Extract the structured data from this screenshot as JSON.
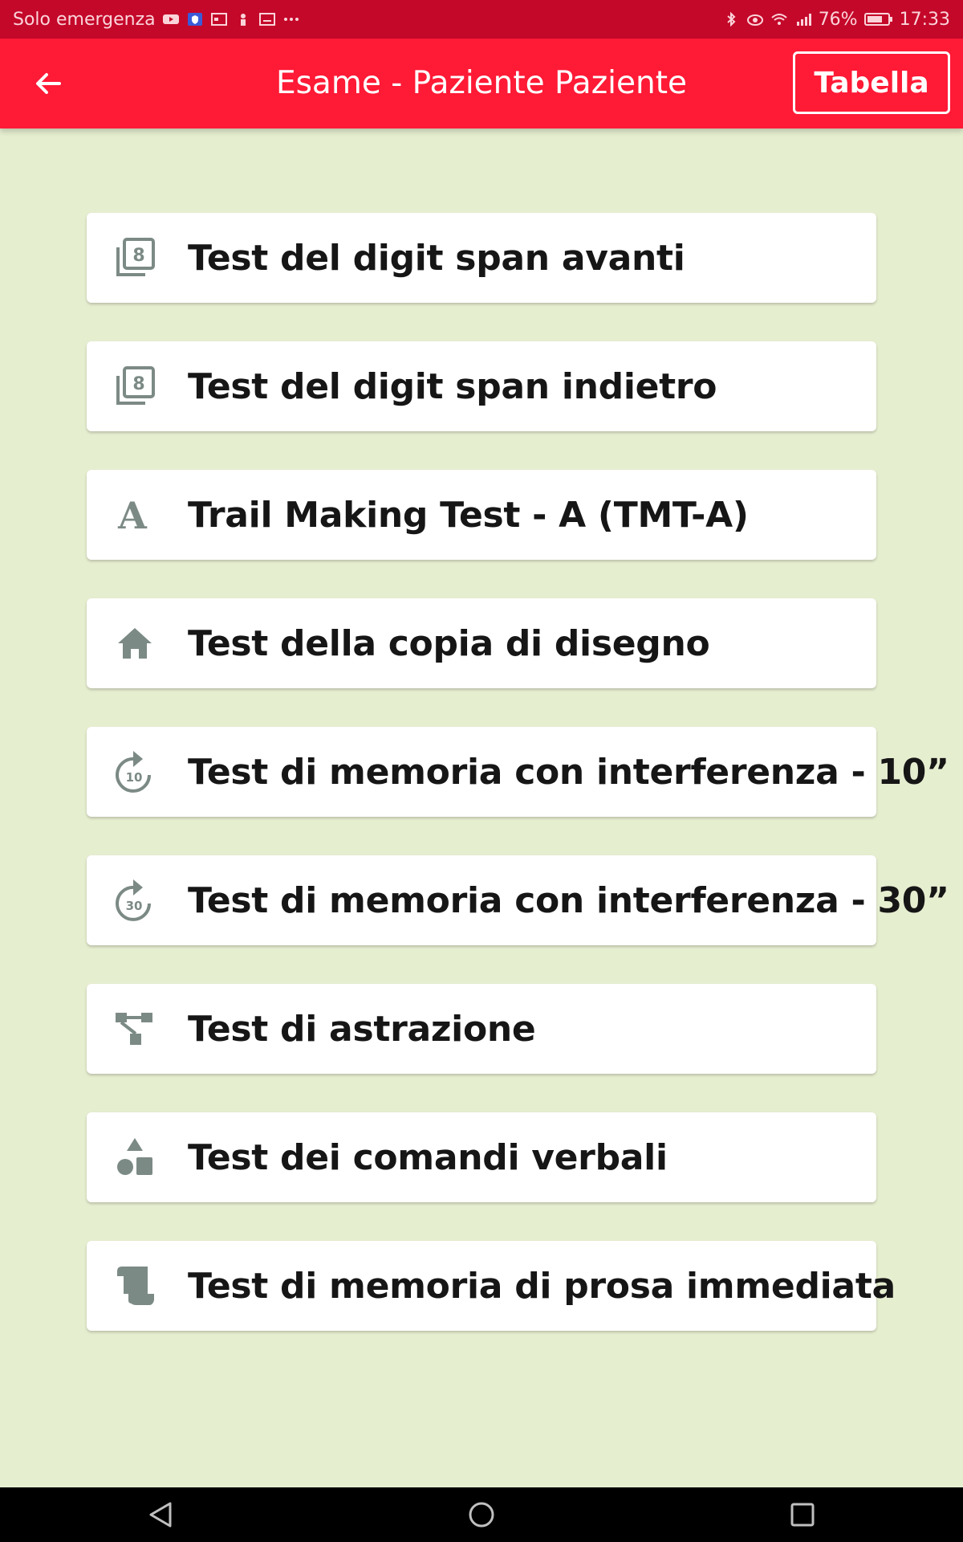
{
  "status_bar": {
    "carrier": "Solo emergenza",
    "battery": "76%",
    "time": "17:33"
  },
  "app_bar": {
    "title": "Esame - Paziente Paziente",
    "table_button": "Tabella"
  },
  "tests": [
    {
      "label": "Test del digit span avanti",
      "icon": "filter-8-icon"
    },
    {
      "label": "Test del digit span indietro",
      "icon": "filter-8-icon"
    },
    {
      "label": "Trail Making Test - A (TMT-A)",
      "icon": "letter-a-icon"
    },
    {
      "label": "Test della copia di disegno",
      "icon": "home-icon"
    },
    {
      "label": "Test di memoria con  interferenza - 10”",
      "icon": "forward-10-icon"
    },
    {
      "label": "Test di memoria con interferenza - 30”",
      "icon": "forward-30-icon"
    },
    {
      "label": "Test di astrazione",
      "icon": "flow-chart-icon"
    },
    {
      "label": "Test dei comandi verbali",
      "icon": "shapes-icon"
    },
    {
      "label": "Test di memoria di prosa immediata",
      "icon": "scroll-icon"
    }
  ]
}
